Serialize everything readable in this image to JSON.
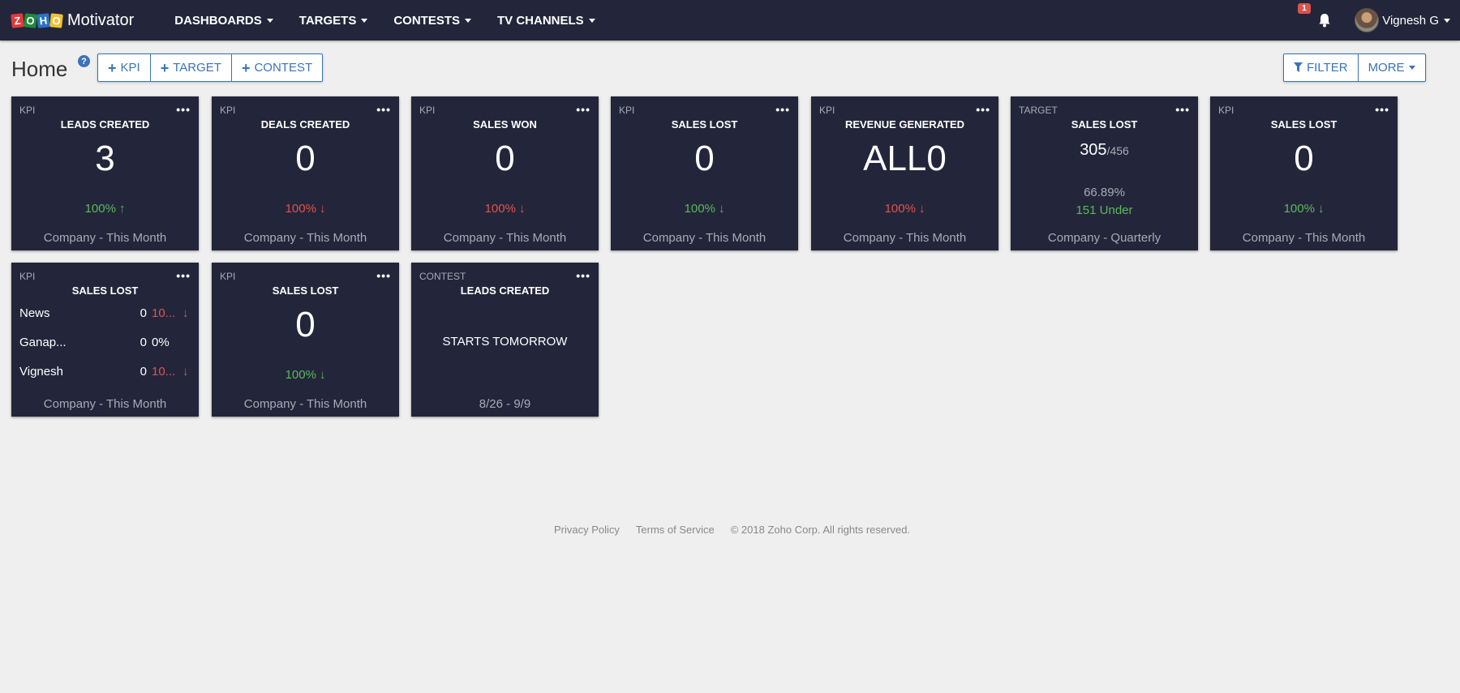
{
  "nav": {
    "brand": "Motivator",
    "logo_letters": [
      "Z",
      "O",
      "H",
      "O"
    ],
    "items": [
      {
        "label": "DASHBOARDS"
      },
      {
        "label": "TARGETS"
      },
      {
        "label": "CONTESTS"
      },
      {
        "label": "TV CHANNELS"
      }
    ],
    "notification_count": "1",
    "user_name": "Vignesh G"
  },
  "toolbar": {
    "title": "Home",
    "help": "?",
    "add_kpi": "KPI",
    "add_target": "TARGET",
    "add_contest": "CONTEST",
    "filter": "FILTER",
    "more": "MORE"
  },
  "cards": [
    {
      "type": "KPI",
      "title": "LEADS CREATED",
      "value": "3",
      "change": "100%",
      "footer": "Company - This Month"
    },
    {
      "type": "KPI",
      "title": "DEALS CREATED",
      "value": "0",
      "change": "100%",
      "footer": "Company - This Month"
    },
    {
      "type": "KPI",
      "title": "SALES WON",
      "value": "0",
      "change": "100%",
      "footer": "Company - This Month"
    },
    {
      "type": "KPI",
      "title": "SALES LOST",
      "value": "0",
      "change": "100%",
      "footer": "Company - This Month"
    },
    {
      "type": "KPI",
      "title": "REVENUE GENERATED",
      "value": "ALL0",
      "change": "100%",
      "footer": "Company - This Month"
    },
    {
      "type": "TARGET",
      "title": "SALES LOST",
      "achieved": "305",
      "total": "/456",
      "percent": "66.89%",
      "status": "151 Under",
      "footer": "Company - Quarterly"
    },
    {
      "type": "KPI",
      "title": "SALES LOST",
      "value": "0",
      "change": "100%",
      "footer": "Company - This Month"
    },
    {
      "type": "KPI",
      "title": "SALES LOST",
      "rows": [
        {
          "name": "News",
          "value": "0",
          "pct": "10..."
        },
        {
          "name": "Ganap...",
          "value": "0",
          "pct": "0%"
        },
        {
          "name": "Vignesh",
          "value": "0",
          "pct": "10..."
        }
      ],
      "footer": "Company - This Month"
    },
    {
      "type": "KPI",
      "title": "SALES LOST",
      "value": "0",
      "change": "100%",
      "footer": "Company - This Month"
    },
    {
      "type": "CONTEST",
      "title": "LEADS CREATED",
      "status": "STARTS TOMORROW",
      "footer": "8/26 - 9/9"
    }
  ],
  "footer": {
    "privacy": "Privacy Policy",
    "terms": "Terms of Service",
    "copyright": "© 2018 Zoho Corp. All rights reserved."
  },
  "colors": {
    "nav_bg": "#23263a",
    "card_bg": "#23263a",
    "accent": "#3b73b9",
    "positive": "#5cb85c",
    "negative": "#e0524f"
  }
}
